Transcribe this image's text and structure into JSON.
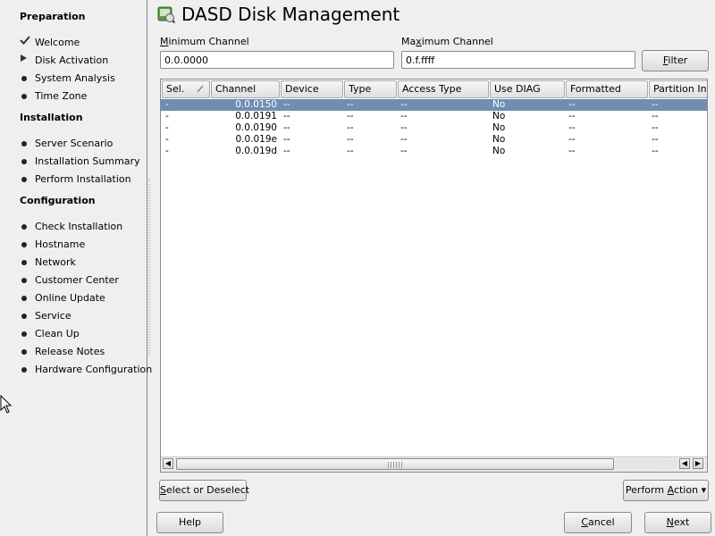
{
  "window": {
    "title": "DASD Disk Management"
  },
  "sidebar": {
    "sections": [
      {
        "title": "Preparation",
        "steps": [
          {
            "label": "Welcome",
            "status": "done"
          },
          {
            "label": "Disk Activation",
            "status": "current"
          },
          {
            "label": "System Analysis",
            "status": "todo"
          },
          {
            "label": "Time Zone",
            "status": "todo"
          }
        ]
      },
      {
        "title": "Installation",
        "steps": [
          {
            "label": "Server Scenario",
            "status": "todo"
          },
          {
            "label": "Installation Summary",
            "status": "todo"
          },
          {
            "label": "Perform Installation",
            "status": "todo"
          }
        ]
      },
      {
        "title": "Configuration",
        "steps": [
          {
            "label": "Check Installation",
            "status": "todo"
          },
          {
            "label": "Hostname",
            "status": "todo"
          },
          {
            "label": "Network",
            "status": "todo"
          },
          {
            "label": "Customer Center",
            "status": "todo"
          },
          {
            "label": "Online Update",
            "status": "todo"
          },
          {
            "label": "Service",
            "status": "todo"
          },
          {
            "label": "Clean Up",
            "status": "todo"
          },
          {
            "label": "Release Notes",
            "status": "todo"
          },
          {
            "label": "Hardware Configuration",
            "status": "todo"
          }
        ]
      }
    ]
  },
  "filter": {
    "min_label_hotkey": "M",
    "min_label_rest": "inimum Channel",
    "min_value": "0.0.0000",
    "max_label_pre": "Ma",
    "max_label_hotkey": "x",
    "max_label_rest": "imum Channel",
    "max_value": "0.f.ffff",
    "button_hotkey": "F",
    "button_rest": "ilter"
  },
  "table": {
    "columns": [
      "Sel.",
      "Channel",
      "Device",
      "Type",
      "Access Type",
      "Use DIAG",
      "Formatted",
      "Partition Info"
    ],
    "rows": [
      [
        "-",
        "0.0.0150",
        "--",
        "--",
        "--",
        "No",
        "--",
        "--"
      ],
      [
        "-",
        "0.0.0191",
        "--",
        "--",
        "--",
        "No",
        "--",
        "--"
      ],
      [
        "-",
        "0.0.0190",
        "--",
        "--",
        "--",
        "No",
        "--",
        "--"
      ],
      [
        "-",
        "0.0.019e",
        "--",
        "--",
        "--",
        "No",
        "--",
        "--"
      ],
      [
        "-",
        "0.0.019d",
        "--",
        "--",
        "--",
        "No",
        "--",
        "--"
      ]
    ],
    "selected_row": 0
  },
  "actions": {
    "select_hotkey": "S",
    "select_rest": "elect or Deselect",
    "perform_pre": "Perform ",
    "perform_hotkey": "A",
    "perform_rest": "ction",
    "help": "Help",
    "cancel_hotkey": "C",
    "cancel_rest": "ancel",
    "next_hotkey": "N",
    "next_rest": "ext"
  },
  "colors": {
    "selection": "#6f8eb2",
    "background": "#efefef"
  }
}
